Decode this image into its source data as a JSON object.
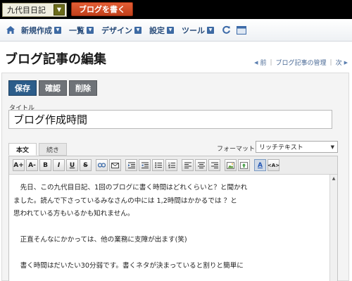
{
  "topbar": {
    "blog_name": "九代目日記",
    "write_button": "ブログを書く"
  },
  "menu": {
    "items": [
      "新規作成",
      "一覧",
      "デザイン",
      "設定",
      "ツール"
    ]
  },
  "page": {
    "title": "ブログ記事の編集",
    "nav_prev": "前",
    "nav_manage": "ブログ記事の管理",
    "nav_next": "次"
  },
  "actions": {
    "save": "保存",
    "confirm": "確認",
    "delete": "削除"
  },
  "form": {
    "title_label": "タイトル",
    "title_value": "ブログ作成時間",
    "tab_body": "本文",
    "tab_more": "続き",
    "format_label": "フォーマット:",
    "format_value": "リッチテキスト"
  },
  "toolbar": {
    "font_up": "A+",
    "font_down": "A-",
    "bold": "B",
    "italic": "I",
    "underline": "U",
    "strike": "S",
    "text_color": "A",
    "html": "<A>"
  },
  "body": {
    "line1": "　先日、この九代目日記、1回のブログに書く時間はどれくらいと？と聞かれ",
    "line2": "ました。読んで下さっているみなさんの中には 1,2時間はかかるでは ？と",
    "line3": "思われている方もいるかも知れません。",
    "line4": "　正直そんなにかかっては、他の業務に支障が出ます(笑)",
    "line5": "　書く時間はだいたい30分弱です。書くネタが決まっていると割りと簡単に"
  }
}
